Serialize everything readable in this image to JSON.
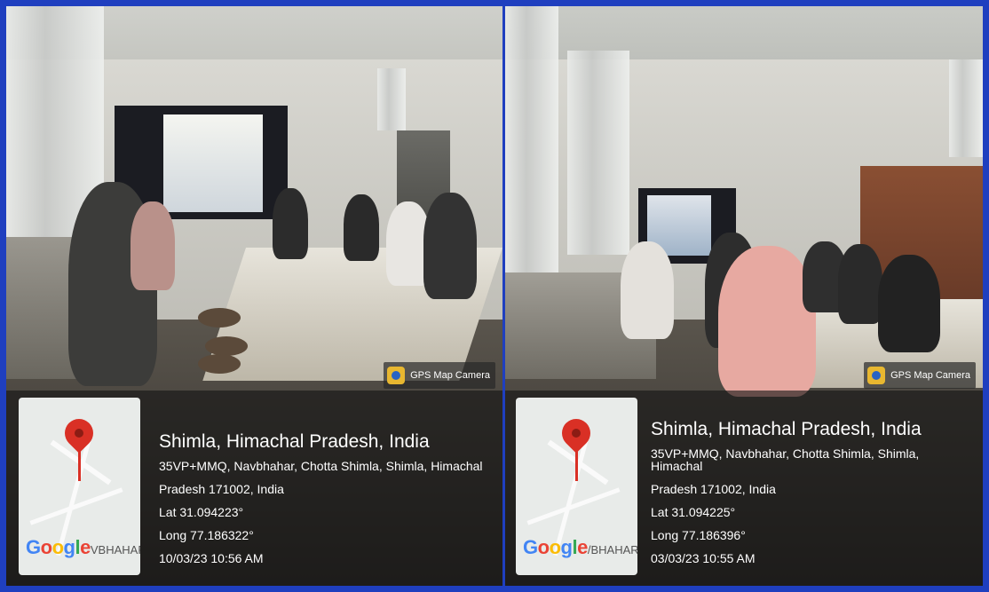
{
  "photos": [
    {
      "badge": "GPS Map Camera",
      "map_logo": "Google",
      "map_logo_suffix": "VBHAHAR",
      "city": "Shimla, Himachal Pradesh, India",
      "address_line1": "35VP+MMQ, Navbhahar, Chotta Shimla, Shimla, Himachal",
      "address_line2": "Pradesh 171002, India",
      "lat": "Lat 31.094223°",
      "long": "Long 77.186322°",
      "datetime": "10/03/23 10:56 AM"
    },
    {
      "badge": "GPS Map Camera",
      "map_logo": "Google",
      "map_logo_suffix": "/BHAHAR",
      "city": "Shimla, Himachal Pradesh, India",
      "address_line1": "35VP+MMQ, Navbhahar, Chotta Shimla, Shimla, Himachal",
      "address_line2": "Pradesh 171002, India",
      "lat": "Lat 31.094225°",
      "long": "Long 77.186396°",
      "datetime": "03/03/23 10:55 AM"
    }
  ],
  "colors": {
    "frame": "#1f3fbf",
    "pin": "#d93025"
  }
}
